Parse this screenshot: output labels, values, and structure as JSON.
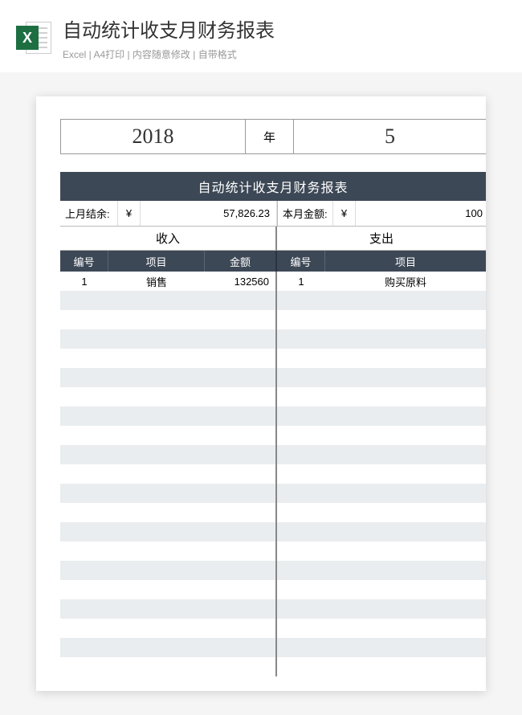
{
  "header": {
    "title": "自动统计收支月财务报表",
    "meta": "Excel | A4打印 | 内容随意修改 | 自带格式",
    "icon_letter": "X"
  },
  "sheet": {
    "year": "2018",
    "year_label": "年",
    "month": "5",
    "title": "自动统计收支月财务报表",
    "prev_balance_label": "上月结余:",
    "currency": "¥",
    "prev_balance_value": "57,826.23",
    "this_month_label": "本月金额:",
    "this_month_value": "100",
    "income_label": "收入",
    "expense_label": "支出",
    "col_num": "编号",
    "col_item": "项目",
    "col_amount": "金额",
    "income_rows": [
      {
        "num": "1",
        "item": "销售",
        "amount": "132560"
      }
    ],
    "expense_rows": [
      {
        "num": "1",
        "item": "购买原料"
      }
    ],
    "empty_row_count": 20
  }
}
